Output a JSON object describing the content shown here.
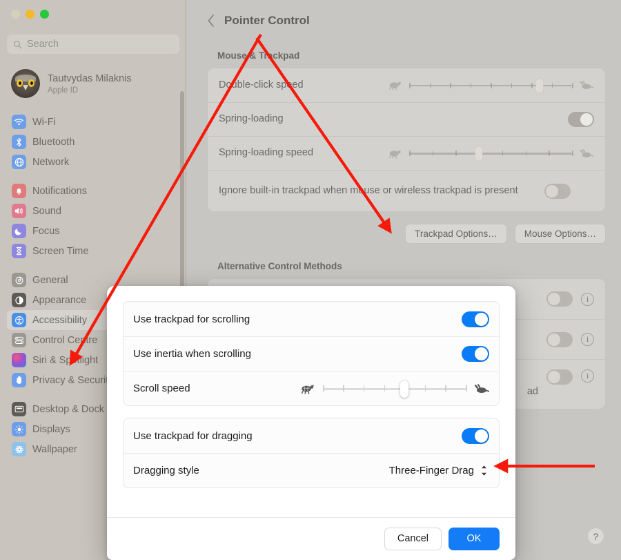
{
  "window": {
    "traffic_lights": [
      "close",
      "minimize",
      "maximize"
    ]
  },
  "sidebar": {
    "search": {
      "placeholder": "Search",
      "icon": "search-icon"
    },
    "account": {
      "name": "Tautvydas Milaknis",
      "subtitle": "Apple ID",
      "avatar": "owl-avatar"
    },
    "groups": [
      {
        "items": [
          {
            "label": "Wi-Fi",
            "icon": "wifi-icon",
            "color": "#6f9ee8",
            "selected": false
          },
          {
            "label": "Bluetooth",
            "icon": "bluetooth-icon",
            "color": "#6f9ee8",
            "selected": false
          },
          {
            "label": "Network",
            "icon": "globe-icon",
            "color": "#6f9ee8",
            "selected": false
          }
        ]
      },
      {
        "items": [
          {
            "label": "Notifications",
            "icon": "bell-icon",
            "color": "#e07b7b",
            "selected": false
          },
          {
            "label": "Sound",
            "icon": "speaker-icon",
            "color": "#e07b8f",
            "selected": false
          },
          {
            "label": "Focus",
            "icon": "moon-icon",
            "color": "#8e87e0",
            "selected": false
          },
          {
            "label": "Screen Time",
            "icon": "hourglass-icon",
            "color": "#8e87e0",
            "selected": false
          }
        ]
      },
      {
        "items": [
          {
            "label": "General",
            "icon": "gear-icon",
            "color": "#9b9892",
            "selected": false
          },
          {
            "label": "Appearance",
            "icon": "contrast-icon",
            "color": "#6b6863",
            "selected": false
          },
          {
            "label": "Accessibility",
            "icon": "accessibility-icon",
            "color": "#4a8ee8",
            "selected": true
          },
          {
            "label": "Control Centre",
            "icon": "control-centre-icon",
            "color": "#9b9892",
            "selected": false
          },
          {
            "label": "Siri & Spotlight",
            "icon": "siri-icon",
            "color": "#8a6ab0",
            "selected": false
          },
          {
            "label": "Privacy & Security",
            "icon": "hand-icon",
            "color": "#6f9ee8",
            "selected": false
          }
        ]
      },
      {
        "items": [
          {
            "label": "Desktop & Dock",
            "icon": "dock-icon",
            "color": "#6b6863",
            "selected": false
          },
          {
            "label": "Displays",
            "icon": "brightness-icon",
            "color": "#6f9ee8",
            "selected": false
          },
          {
            "label": "Wallpaper",
            "icon": "wallpaper-icon",
            "color": "#8fc2e8",
            "selected": false
          }
        ]
      }
    ]
  },
  "pane": {
    "back_icon": "chevron-left-icon",
    "title": "Pointer Control",
    "section_mouse": "Mouse & Trackpad",
    "rows": [
      {
        "label": "Double-click speed",
        "control": "slider",
        "ticks": 9,
        "thumb_index": 7
      },
      {
        "label": "Spring-loading",
        "control": "toggle",
        "value": "on"
      },
      {
        "label": "Spring-loading speed",
        "control": "slider",
        "ticks": 8,
        "thumb_index": 3
      },
      {
        "label": "Ignore built-in trackpad when mouse or wireless trackpad is present",
        "control": "toggle",
        "value": "off"
      }
    ],
    "buttons": [
      {
        "label": "Trackpad Options…"
      },
      {
        "label": "Mouse Options…"
      }
    ],
    "section_alt": "Alternative Control Methods",
    "alt_rows": [
      {
        "toggle": "off",
        "info": "i"
      },
      {
        "toggle": "off",
        "info": "i"
      },
      {
        "toggle": "off",
        "info": "i"
      }
    ],
    "alt_partial_text": "ad",
    "help_label": "?"
  },
  "dialog": {
    "groups": [
      {
        "rows": [
          {
            "label": "Use trackpad for scrolling",
            "control": "toggle",
            "value": "on"
          },
          {
            "label": "Use inertia when scrolling",
            "control": "toggle",
            "value": "on"
          },
          {
            "label": "Scroll speed",
            "control": "slider",
            "ticks": 8,
            "thumb_index": 4,
            "left_icon": "turtle-icon",
            "right_icon": "rabbit-icon"
          }
        ]
      },
      {
        "rows": [
          {
            "label": "Use trackpad for dragging",
            "control": "toggle",
            "value": "on"
          },
          {
            "label": "Dragging style",
            "control": "popup",
            "value": "Three-Finger Drag"
          }
        ]
      }
    ],
    "cancel_label": "Cancel",
    "ok_label": "OK",
    "accent_color": "#157cf8"
  },
  "annotations": {
    "color": "#f51a0a",
    "arrows": [
      {
        "name": "arrow-to-accessibility",
        "from": [
          378,
          50
        ],
        "to": [
          100,
          528
        ]
      },
      {
        "name": "arrow-to-trackpad-options",
        "from": [
          372,
          53
        ],
        "to": [
          566,
          335
        ]
      },
      {
        "name": "arrow-to-dragging-style",
        "from": [
          862,
          675
        ],
        "to": [
          716,
          675
        ]
      }
    ]
  }
}
